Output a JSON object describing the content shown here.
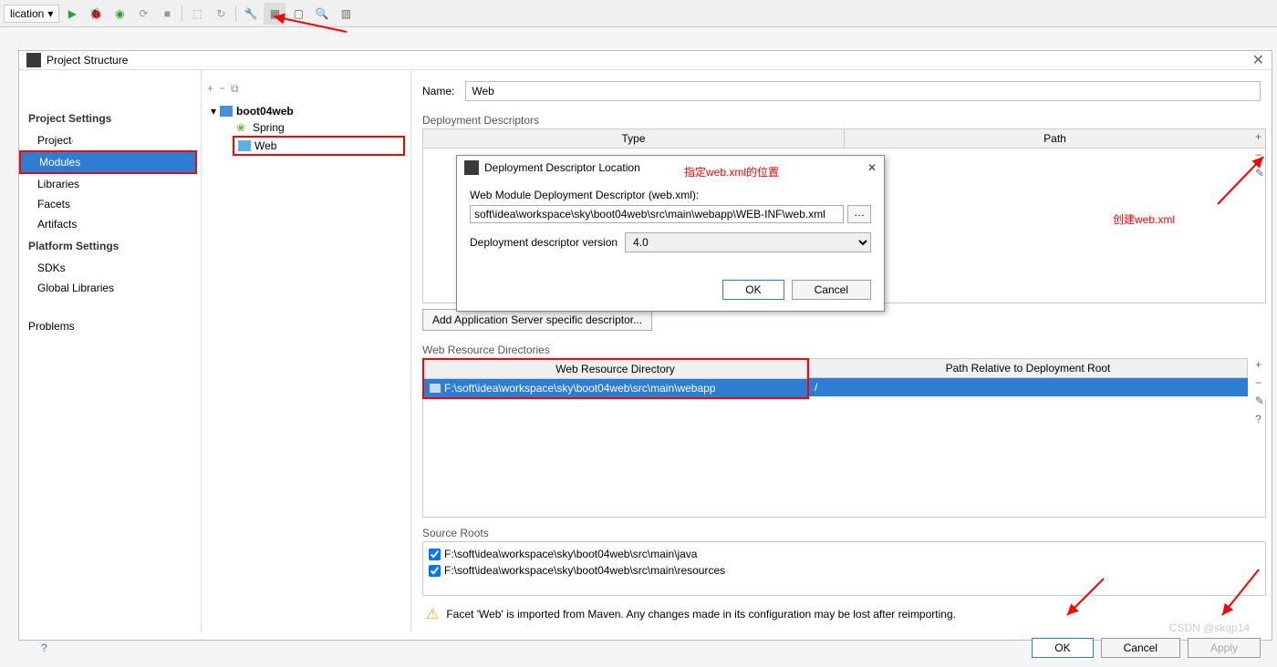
{
  "toolbar": {
    "dropdown_text": "lication"
  },
  "dialog": {
    "title": "Project Structure",
    "sidebar": {
      "project_settings_heading": "Project Settings",
      "items_ps": [
        "Project",
        "Modules",
        "Libraries",
        "Facets",
        "Artifacts"
      ],
      "platform_settings_heading": "Platform Settings",
      "items_pls": [
        "SDKs",
        "Global Libraries"
      ],
      "problems": "Problems"
    },
    "tree": {
      "root": "boot04web",
      "spring": "Spring",
      "web": "Web"
    },
    "main": {
      "name_label": "Name:",
      "name_value": "Web",
      "deploy_desc_label": "Deployment Descriptors",
      "col_type": "Type",
      "col_path": "Path",
      "add_descriptor_btn": "Add Application Server specific descriptor...",
      "web_res_label": "Web Resource Directories",
      "res_col1": "Web Resource Directory",
      "res_col2": "Path Relative to Deployment Root",
      "res_row_dir": "F:\\soft\\idea\\workspace\\sky\\boot04web\\src\\main\\webapp",
      "res_row_rel": "/",
      "source_roots_label": "Source Roots",
      "source_root_1": "F:\\soft\\idea\\workspace\\sky\\boot04web\\src\\main\\java",
      "source_root_2": "F:\\soft\\idea\\workspace\\sky\\boot04web\\src\\main\\resources",
      "warning_text": "Facet 'Web' is imported from Maven. Any changes made in its configuration may be lost after reimporting."
    },
    "buttons": {
      "ok": "OK",
      "cancel": "Cancel",
      "apply": "Apply"
    }
  },
  "inner_dialog": {
    "title": "Deployment Descriptor Location",
    "label_descriptor": "Web Module Deployment Descriptor (web.xml):",
    "descriptor_value": "soft\\idea\\workspace\\sky\\boot04web\\src\\main\\webapp\\WEB-INF\\web.xml",
    "label_version": "Deployment descriptor version",
    "version_value": "4.0",
    "ok": "OK",
    "cancel": "Cancel"
  },
  "annotations": {
    "specify_location": "指定web.xml的位置",
    "create_webxml": "创建web.xml"
  },
  "watermark": "CSDN @skqp14"
}
